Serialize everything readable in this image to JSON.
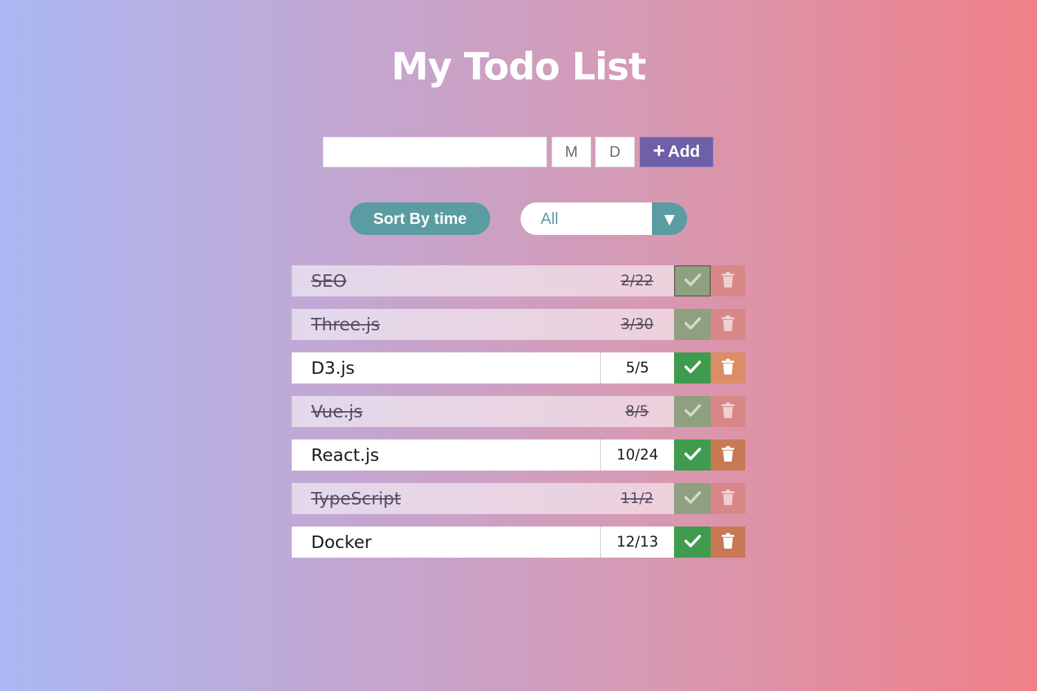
{
  "app": {
    "title": "My Todo List"
  },
  "add_form": {
    "task_placeholder": "",
    "month_placeholder": "M",
    "day_placeholder": "D",
    "add_label": "Add",
    "add_icon": "plus-icon"
  },
  "controls": {
    "sort_label": "Sort By time",
    "filter_value": "All",
    "filter_arrow": "▼"
  },
  "todos": [
    {
      "text": "SEO",
      "date": "2/22",
      "completed": true
    },
    {
      "text": "Three.js",
      "date": "3/30",
      "completed": true
    },
    {
      "text": "D3.js",
      "date": "5/5",
      "completed": false
    },
    {
      "text": "Vue.js",
      "date": "8/5",
      "completed": true
    },
    {
      "text": "React.js",
      "date": "10/24",
      "completed": false
    },
    {
      "text": "TypeScript",
      "date": "11/2",
      "completed": true
    },
    {
      "text": "Docker",
      "date": "12/13",
      "completed": false
    }
  ],
  "icons": {
    "complete": "check-icon",
    "delete": "trash-icon"
  },
  "colors": {
    "complete_button": "#3f9c4f",
    "delete_button": "#c77a53",
    "add_button": "#6e5fa8",
    "accent": "#5b9ba2"
  }
}
